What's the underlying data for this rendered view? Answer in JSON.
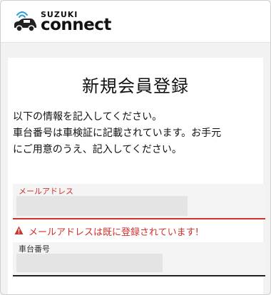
{
  "header": {
    "logo_brand": "SUZUKI",
    "logo_word": "connect",
    "logo_icon": "car-wifi-icon"
  },
  "page": {
    "title": "新規会員登録",
    "instructions": [
      "以下の情報を記入してください。",
      "車台番号は車検証に記載されています。お手元",
      "にご用意のうえ、記入してください。"
    ]
  },
  "form": {
    "email": {
      "label": "メールアドレス",
      "value": ""
    },
    "error": {
      "icon": "warning-icon",
      "message": "メールアドレスは既に登録されています!"
    },
    "vehicle_number": {
      "label": "車台番号",
      "value": ""
    }
  },
  "colors": {
    "error": "#d0312d",
    "accent_blue": "#2a9fd6",
    "text": "#111111"
  }
}
